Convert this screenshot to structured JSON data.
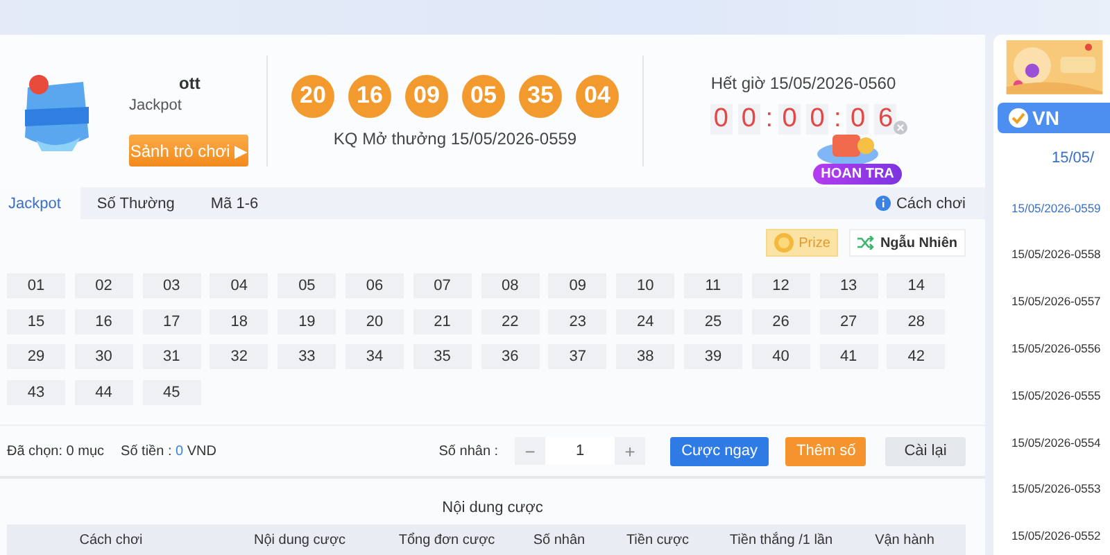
{
  "game": {
    "title": "ott",
    "subtitle": "Jackpot",
    "lobby_button": {
      "label": "Sảnh trò chơi",
      "icon": "▶"
    }
  },
  "result": {
    "balls": [
      "20",
      "16",
      "09",
      "05",
      "35",
      "04"
    ],
    "caption": "KQ Mở thưởng 15/05/2026-0559"
  },
  "countdown": {
    "caption": "Hết giờ 15/05/2026-0560",
    "digits": [
      "0",
      "0",
      ":",
      "0",
      "0",
      ":",
      "0",
      "6"
    ]
  },
  "promo": {
    "label": "HOAN TRA"
  },
  "tabs": [
    {
      "label": "Jackpot",
      "selected": true
    },
    {
      "label": "Số Thường",
      "selected": false
    },
    {
      "label": "Mã 1-6",
      "selected": false
    }
  ],
  "help_link": "Cách chơi",
  "tools": [
    {
      "kind": "prize",
      "label": "Prize"
    },
    {
      "kind": "random",
      "label": "Ngẫu Nhiên"
    }
  ],
  "numbers": [
    {
      "label": "01",
      "selected": false
    },
    {
      "label": "02",
      "selected": false
    },
    {
      "label": "03",
      "selected": false
    },
    {
      "label": "04",
      "selected": false
    },
    {
      "label": "05",
      "selected": false
    },
    {
      "label": "06",
      "selected": false
    },
    {
      "label": "07",
      "selected": false
    },
    {
      "label": "08",
      "selected": false
    },
    {
      "label": "09",
      "selected": false
    },
    {
      "label": "10",
      "selected": false
    },
    {
      "label": "11",
      "selected": false
    },
    {
      "label": "12",
      "selected": false
    },
    {
      "label": "13",
      "selected": false
    },
    {
      "label": "14",
      "selected": false
    },
    {
      "label": "15",
      "selected": false
    },
    {
      "label": "16",
      "selected": false
    },
    {
      "label": "17",
      "selected": false
    },
    {
      "label": "18",
      "selected": false
    },
    {
      "label": "19",
      "selected": false
    },
    {
      "label": "20",
      "selected": false
    },
    {
      "label": "21",
      "selected": false
    },
    {
      "label": "22",
      "selected": false
    },
    {
      "label": "23",
      "selected": false
    },
    {
      "label": "24",
      "selected": false
    },
    {
      "label": "25",
      "selected": false
    },
    {
      "label": "26",
      "selected": false
    },
    {
      "label": "27",
      "selected": false
    },
    {
      "label": "28",
      "selected": false
    },
    {
      "label": "29",
      "selected": false
    },
    {
      "label": "30",
      "selected": false
    },
    {
      "label": "31",
      "selected": false
    },
    {
      "label": "32",
      "selected": false
    },
    {
      "label": "33",
      "selected": false
    },
    {
      "label": "34",
      "selected": false
    },
    {
      "label": "35",
      "selected": false
    },
    {
      "label": "36",
      "selected": false
    },
    {
      "label": "37",
      "selected": false
    },
    {
      "label": "38",
      "selected": false
    },
    {
      "label": "39",
      "selected": false
    },
    {
      "label": "40",
      "selected": false
    },
    {
      "label": "41",
      "selected": false
    },
    {
      "label": "42",
      "selected": false
    },
    {
      "label": "43",
      "selected": false
    },
    {
      "label": "44",
      "selected": false
    },
    {
      "label": "45",
      "selected": false
    }
  ],
  "summary": {
    "chosen": "Đã chọn: 0 mục",
    "amount_label": "Số tiền :",
    "amount": "0",
    "currency": "VND"
  },
  "multiplier": {
    "label": "Số nhân :",
    "minus": "−",
    "value": "1",
    "plus": "+"
  },
  "actions": [
    {
      "kind": "primary",
      "label": "Cược ngay"
    },
    {
      "kind": "accent",
      "label": "Thêm số"
    },
    {
      "kind": "plain",
      "label": "Cài lại"
    }
  ],
  "bets": {
    "title": "Nội dung cược",
    "columns": [
      "Cách chơi",
      "Nội dung cược",
      "Tổng đơn cược",
      "Số nhân",
      "Tiền cược",
      "Tiền thắng /1 lần",
      "Vận hành"
    ]
  },
  "sidebar": {
    "provider": "VN",
    "period_header": "15/05/",
    "periods": [
      {
        "label": "15/05/2026-0559",
        "selected": true
      },
      {
        "label": "15/05/2026-0558",
        "selected": false
      },
      {
        "label": "15/05/2026-0557",
        "selected": false
      },
      {
        "label": "15/05/2026-0556",
        "selected": false
      },
      {
        "label": "15/05/2026-0555",
        "selected": false
      },
      {
        "label": "15/05/2026-0554",
        "selected": false
      },
      {
        "label": "15/05/2026-0553",
        "selected": false
      },
      {
        "label": "15/05/2026-0552",
        "selected": false
      }
    ]
  }
}
